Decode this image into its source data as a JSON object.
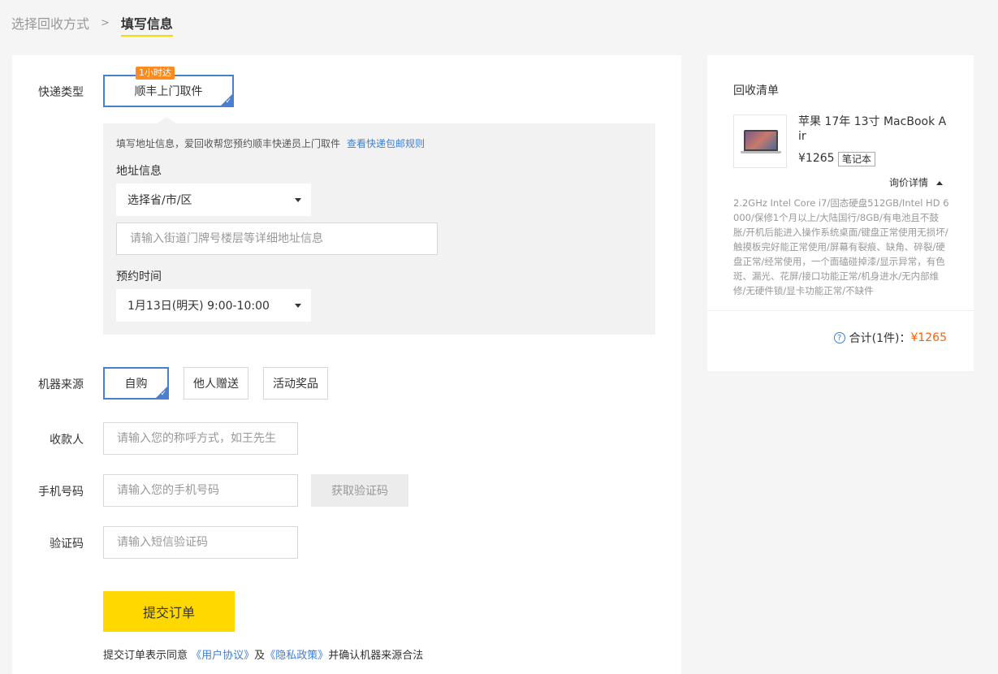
{
  "breadcrumb": {
    "step1": "选择回收方式",
    "separator": ">",
    "step2": "填写信息"
  },
  "form": {
    "express_label": "快递类型",
    "express_option": "顺丰上门取件",
    "express_badge": "1小时达",
    "address_tip": "填写地址信息，爱回收帮您预约顺丰快递员上门取件",
    "address_tip_link": "查看快递包邮规则",
    "address_title": "地址信息",
    "region_select": "选择省/市/区",
    "street_placeholder": "请输入街道门牌号楼层等详细地址信息",
    "time_title": "预约时间",
    "time_select": "1月13日(明天) 9:00-10:00",
    "source_label": "机器来源",
    "source_options": [
      "自购",
      "他人赠送",
      "活动奖品"
    ],
    "source_selected": "自购",
    "payee_label": "收款人",
    "payee_placeholder": "请输入您的称呼方式，如王先生",
    "phone_label": "手机号码",
    "phone_placeholder": "请输入您的手机号码",
    "get_code_label": "获取验证码",
    "code_label": "验证码",
    "code_placeholder": "请输入短信验证码",
    "submit_label": "提交订单",
    "agree_prefix": "提交订单表示同意",
    "agree_link1": "《用户协议》",
    "agree_mid": "及",
    "agree_link2": "《隐私政策》",
    "agree_suffix": "并确认机器来源合法"
  },
  "sidebar": {
    "title": "回收清单",
    "product_name": "苹果 17年 13寸 MacBook Air",
    "product_price": "¥1265",
    "product_tag": "笔记本",
    "inquiry_label": "询价详情",
    "spec_text": "2.2GHz Intel Core i7/固态硬盘512GB/Intel HD 6000/保修1个月以上/大陆国行/8GB/有电池且不鼓胀/开机后能进入操作系统桌面/键盘正常使用无损坏/触摸板完好能正常使用/屏幕有裂痕、缺角、碎裂/硬盘正常/经常使用，一个面磕碰掉漆/显示异常，有色斑、漏光、花屏/接口功能正常/机身进水/无内部维修/无硬件锁/显卡功能正常/不缺件",
    "total_label": "合计(1件)：",
    "total_amount": "¥1265"
  },
  "colors": {
    "accent_yellow": "#ffd800",
    "link_blue": "#3d7fd6",
    "selected_border": "#4a7fd0",
    "badge_orange": "#ff8a1e",
    "price_orange": "#ff6000"
  }
}
